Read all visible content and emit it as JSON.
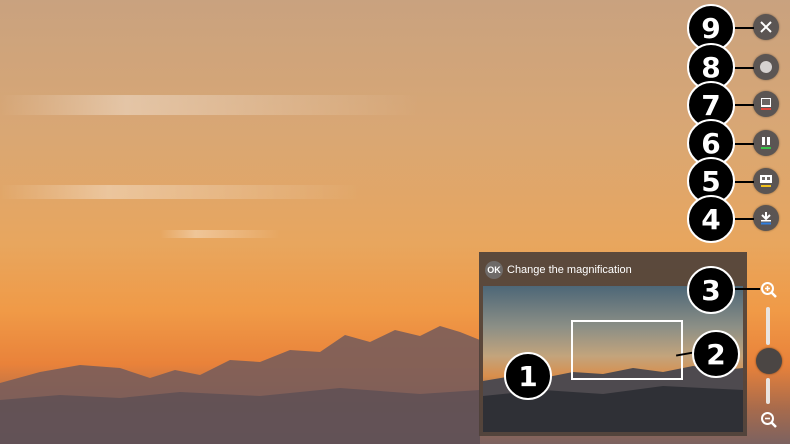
{
  "panel": {
    "ok_label": "OK",
    "header_text": "Change the magnification"
  },
  "callouts": [
    "9",
    "8",
    "7",
    "6",
    "5",
    "4",
    "3",
    "2",
    "1"
  ],
  "icons": {
    "close": "close-icon",
    "record": "record-icon",
    "capture": "capture-icon",
    "pause": "pause-icon",
    "live_tv": "live-tv-icon",
    "download": "download-icon",
    "zoom_in": "zoom-in-icon",
    "zoom_out": "zoom-out-icon"
  },
  "colors": {
    "button_bg": "#5b5553",
    "green": "#39c24a",
    "yellow": "#f2c21c",
    "red": "#e0463c",
    "blue": "#2f7fe0"
  }
}
